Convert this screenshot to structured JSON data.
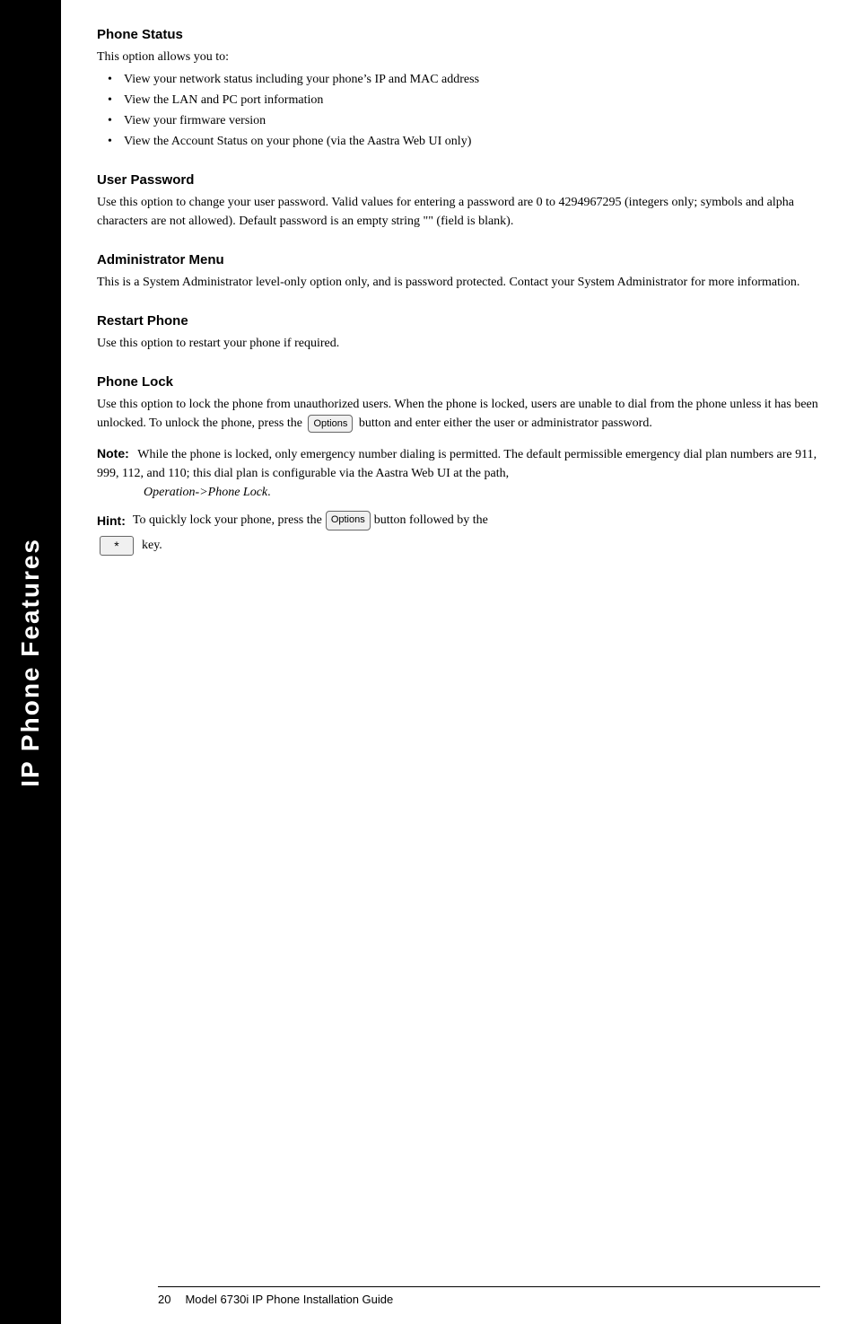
{
  "sidebar": {
    "text": "IP Phone Features"
  },
  "sections": {
    "phone_status": {
      "title": "Phone Status",
      "intro": "This option allows you to:",
      "bullets": [
        "View your network status including your phone’s IP and MAC address",
        "View the LAN and PC port information",
        "View your firmware version",
        "View the Account Status on your phone (via the Aastra Web UI only)"
      ]
    },
    "user_password": {
      "title": "User Password",
      "body": "Use this option to change your user password. Valid values for entering a password are 0 to 4294967295 (integers only; symbols and alpha characters are not allowed). Default password is an empty string \"\" (field is blank)."
    },
    "administrator_menu": {
      "title": "Administrator Menu",
      "body": "This is a System Administrator level-only option only, and is password protected. Contact your System Administrator for more information."
    },
    "restart_phone": {
      "title": "Restart Phone",
      "body": "Use this option to restart your phone if required."
    },
    "phone_lock": {
      "title": "Phone Lock",
      "body1": "Use this option to lock the phone from unauthorized users.  When the phone is locked, users are unable to dial from the phone unless it has been",
      "body2": "unlocked.  To unlock the phone, press the",
      "body2_end": "button and enter either the user or administrator password.",
      "note_label": "Note:",
      "note_text": "While the phone is locked, only emergency number dialing is permitted.  The default permissible emergency dial plan numbers are 911, 999, 112, and 110; this dial plan is configurable via the Aastra Web UI at the path,",
      "note_italic": "Operation->Phone Lock",
      "hint_label": "Hint:",
      "hint_text": "To quickly lock your phone, press the",
      "hint_text2": "button followed by the",
      "hint_key": "★",
      "options_label": "Options",
      "key_symbol": "*"
    }
  },
  "footer": {
    "page_number": "20",
    "text": "Model 6730i IP Phone Installation Guide"
  }
}
